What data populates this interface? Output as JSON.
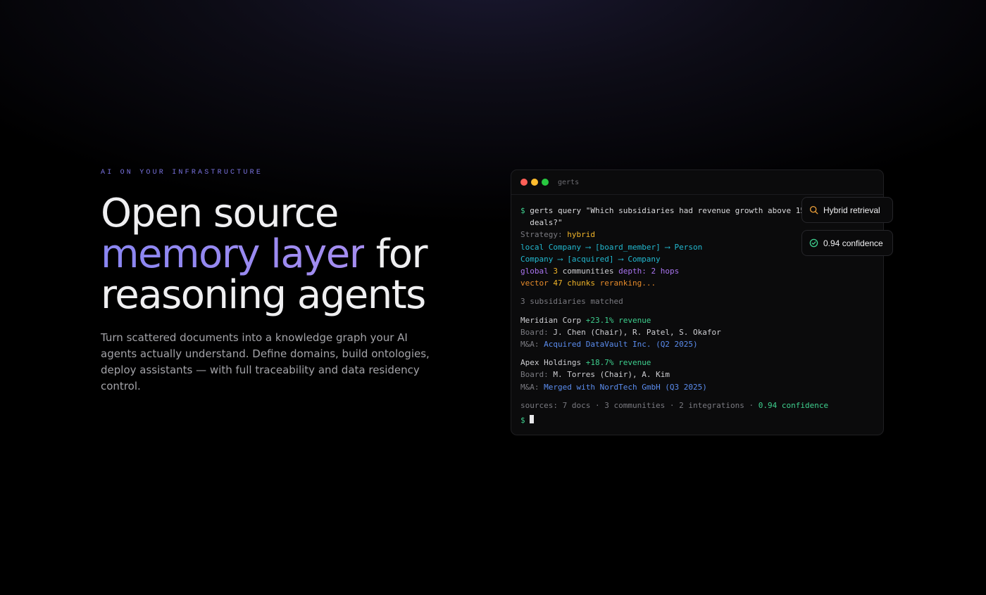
{
  "hero": {
    "eyebrow": "AI ON YOUR INFRASTRUCTURE",
    "headline_line1": "Open source",
    "headline_accent": "memory layer",
    "headline_for": " for",
    "headline_line3": "reasoning agents",
    "lede": "Turn scattered documents into a knowledge graph your AI agents actually understand. Define domains, build ontologies, deploy assistants — with full traceability and data residency control."
  },
  "terminal": {
    "title": "gerts",
    "prompt": "$",
    "command_line1": "gerts query \"Which subsidiaries had revenue growth above 15%",
    "command_line2": "  deals?\"",
    "strategy_label": "Strategy:",
    "strategy_value": "hybrid",
    "local_label": "local",
    "local_path1": "Company ⟶ [board_member] ⟶ Person",
    "local_path2": "Company ⟶ [acquired] ⟶ Company",
    "global_label": "global",
    "global_count": "3",
    "global_unit": "communities",
    "global_depth": "depth: 2 hops",
    "vector_label": "vector",
    "vector_count": "47",
    "vector_unit": "chunks",
    "vector_status": "reranking...",
    "matched": "3 subsidiaries matched",
    "results": [
      {
        "name": "Meridian Corp",
        "growth": "+23.1% revenue",
        "board_label": "Board:",
        "board": "J. Chen (Chair), R. Patel, S. Okafor",
        "ma_label": "M&A:",
        "ma": "Acquired DataVault Inc. (Q2 2025)"
      },
      {
        "name": "Apex Holdings",
        "growth": "+18.7% revenue",
        "board_label": "Board:",
        "board": "M. Torres (Chair), A. Kim",
        "ma_label": "M&A:",
        "ma": "Merged with NordTech GmbH (Q3 2025)"
      }
    ],
    "sources_label": "sources:",
    "sources": "7 docs · 3 communities · 2 integrations ·",
    "confidence": "0.94 confidence"
  },
  "badges": {
    "retrieval": "Hybrid retrieval",
    "confidence": "0.94 confidence"
  },
  "colors": {
    "accent": "#8a86f2",
    "prompt_green": "#3ecf8e",
    "search_icon": "#f0a23a",
    "check_icon": "#3ecf8e"
  },
  "icons": [
    "search-icon",
    "check-circle-icon"
  ]
}
